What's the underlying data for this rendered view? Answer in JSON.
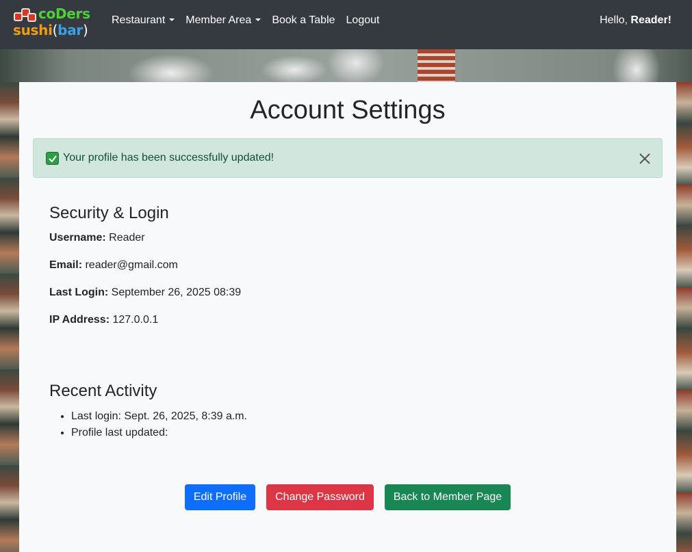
{
  "brand": {
    "line1": "coDers",
    "line2_sushi": "sushi",
    "line2_open": "(",
    "line2_bar": "bar",
    "line2_close": ")"
  },
  "nav": {
    "restaurant": "Restaurant",
    "member_area": "Member Area",
    "book_table": "Book a Table",
    "logout": "Logout",
    "hello_prefix": "Hello, ",
    "hello_name": "Reader!"
  },
  "page": {
    "title": "Account Settings"
  },
  "alert": {
    "message": "Your profile has been successfully updated!"
  },
  "security": {
    "title": "Security & Login",
    "username_label": "Username:",
    "username": "Reader",
    "email_label": "Email:",
    "email": "reader@gmail.com",
    "last_login_label": "Last Login:",
    "last_login": "September 26, 2025 08:39",
    "ip_label": "IP Address:",
    "ip": "127.0.0.1"
  },
  "activity": {
    "title": "Recent Activity",
    "items": [
      "Last login: Sept. 26, 2025, 8:39 a.m.",
      "Profile last updated:"
    ]
  },
  "buttons": {
    "edit": "Edit Profile",
    "change_password": "Change Password",
    "back": "Back to Member Page"
  },
  "colors": {
    "navbar": "#343a40",
    "primary": "#0d6efd",
    "danger": "#dc3545",
    "success": "#198754",
    "alert_bg": "#d1e7dd"
  }
}
